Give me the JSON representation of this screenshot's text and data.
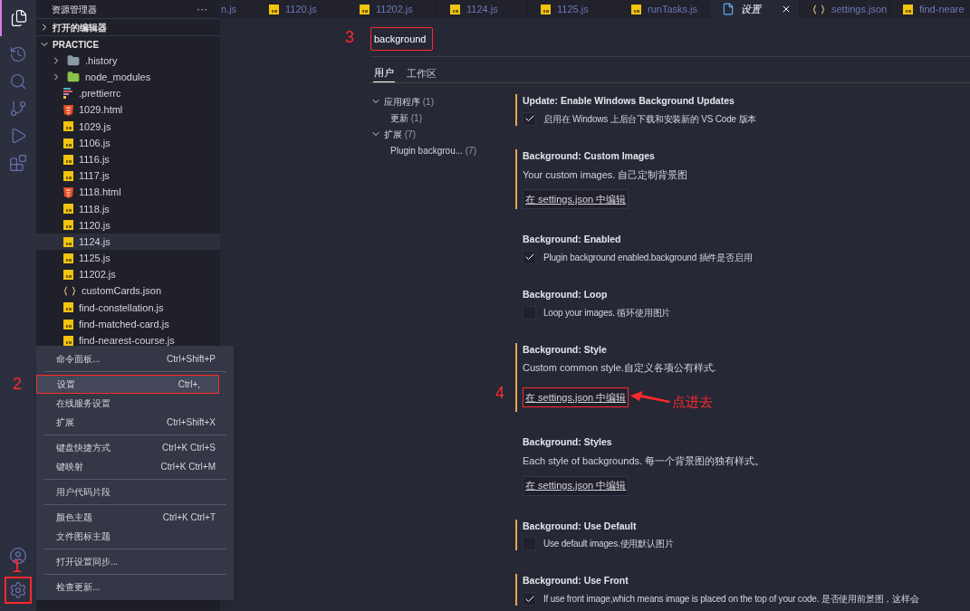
{
  "activity_bar": {
    "top": [
      {
        "kind": "files",
        "selected": true
      },
      {
        "kind": "timeline",
        "selected": false
      },
      {
        "kind": "search",
        "selected": false
      },
      {
        "kind": "source-control",
        "selected": false
      },
      {
        "kind": "run",
        "selected": false
      },
      {
        "kind": "extensions",
        "selected": false
      }
    ],
    "bottom": [
      {
        "kind": "account"
      },
      {
        "kind": "settings",
        "annotation": "1"
      }
    ]
  },
  "sidebar": {
    "title": "资源管理器",
    "more": "···",
    "sections": [
      {
        "label": "打开的编辑器",
        "expanded": false
      },
      {
        "label": "PRACTICE",
        "expanded": true
      }
    ],
    "files": [
      {
        "name": ".history",
        "kind": "folder",
        "selected": false
      },
      {
        "name": "node_modules",
        "kind": "node-folder",
        "selected": false
      },
      {
        "name": ".prettierrc",
        "kind": "prettier",
        "selected": false
      },
      {
        "name": "1029.html",
        "kind": "html",
        "selected": false
      },
      {
        "name": "1029.js",
        "kind": "js",
        "selected": false
      },
      {
        "name": "1106.js",
        "kind": "js",
        "selected": false
      },
      {
        "name": "1116.js",
        "kind": "js",
        "selected": false
      },
      {
        "name": "1117.js",
        "kind": "js",
        "selected": false
      },
      {
        "name": "1118.html",
        "kind": "html",
        "selected": false
      },
      {
        "name": "1118.js",
        "kind": "js",
        "selected": false
      },
      {
        "name": "1120.js",
        "kind": "js",
        "selected": false
      },
      {
        "name": "1124.js",
        "kind": "js",
        "selected": true
      },
      {
        "name": "1125.js",
        "kind": "js",
        "selected": false
      },
      {
        "name": "11202.js",
        "kind": "js",
        "selected": false
      },
      {
        "name": "customCards.json",
        "kind": "json",
        "selected": false
      },
      {
        "name": "find-constellation.js",
        "kind": "js",
        "selected": false
      },
      {
        "name": "find-matched-card.js",
        "kind": "js",
        "selected": false
      },
      {
        "name": "find-nearest-course.js",
        "kind": "js",
        "selected": false
      }
    ]
  },
  "menu": {
    "annotation": "2",
    "groups": [
      [
        {
          "label": "命令面板...",
          "shortcut": "Ctrl+Shift+P",
          "selected": false
        }
      ],
      [
        {
          "label": "设置",
          "shortcut": "Ctrl+,",
          "selected": true
        },
        {
          "label": "在线服务设置",
          "selected": false
        },
        {
          "label": "扩展",
          "shortcut": "Ctrl+Shift+X",
          "selected": false
        }
      ],
      [
        {
          "label": "键盘快捷方式",
          "shortcut": "Ctrl+K Ctrl+S",
          "selected": false
        },
        {
          "label": "键映射",
          "shortcut": "Ctrl+K Ctrl+M",
          "selected": false
        }
      ],
      [
        {
          "label": "用户代码片段",
          "selected": false
        }
      ],
      [
        {
          "label": "颜色主题",
          "shortcut": "Ctrl+K Ctrl+T",
          "selected": false
        },
        {
          "label": "文件图标主题",
          "selected": false
        }
      ],
      [
        {
          "label": "打开设置同步...",
          "selected": false
        }
      ],
      [
        {
          "label": "检查更新...",
          "selected": false
        }
      ]
    ]
  },
  "editor_tabs": [
    {
      "label": "n.js",
      "selected": false
    },
    {
      "label": "1120.js",
      "kind": "js",
      "selected": false
    },
    {
      "label": "11202.js",
      "kind": "js",
      "selected": false
    },
    {
      "label": "1124.js",
      "kind": "js",
      "selected": false
    },
    {
      "label": "1125.js",
      "kind": "js",
      "selected": false
    },
    {
      "label": "runTasks.js",
      "kind": "js",
      "selected": false
    },
    {
      "label": "设置",
      "kind": "settings",
      "selected": true
    },
    {
      "label": "settings.json",
      "kind": "json",
      "selected": false
    },
    {
      "label": "find-neare",
      "kind": "js",
      "selected": false
    }
  ],
  "settings": {
    "search": {
      "value": "background",
      "annotation": "3"
    },
    "scope_tabs": [
      {
        "label": "用户",
        "selected": true
      },
      {
        "label": "工作区",
        "selected": false
      }
    ],
    "toc": [
      {
        "label": "应用程序",
        "count": "(1)",
        "expanded": true,
        "children": [
          {
            "label": "更新",
            "count": "(1)"
          }
        ]
      },
      {
        "label": "扩展",
        "count": "(7)",
        "expanded": true,
        "children": [
          {
            "label": "Plugin backgrou...",
            "count": "(7)"
          }
        ]
      }
    ],
    "items": [
      {
        "title": "Update: Enable Windows Background Updates",
        "kind": "checkbox",
        "modified": true,
        "checked": true,
        "description": "启用在 Windows 上后台下载和安装新的 VS Code 版本"
      },
      {
        "title": "Background: Custom Images",
        "kind": "link",
        "modified": true,
        "description": "Your custom images. 自己定制背景图",
        "link": "在 settings.json 中编辑"
      },
      {
        "title": "Background: Enabled",
        "kind": "checkbox",
        "modified": false,
        "checked": true,
        "description": "Plugin background enabled.background 插件是否启用"
      },
      {
        "title": "Background: Loop",
        "kind": "checkbox",
        "modified": false,
        "checked": false,
        "description": "Loop your images. 循环使用图片"
      },
      {
        "title": "Background: Style",
        "kind": "link",
        "modified": true,
        "description": "Custom common style.自定义各项公有样式.",
        "link": "在 settings.json 中编辑",
        "annotation": "4",
        "callout": "点进去"
      },
      {
        "title": "Background: Styles",
        "kind": "link",
        "modified": false,
        "description": "Each style of backgrounds. 每一个背景图的独有样式。",
        "link": "在 settings.json 中编辑"
      },
      {
        "title": "Background: Use Default",
        "kind": "checkbox",
        "modified": true,
        "checked": false,
        "description": "Use default images.使用默认图片"
      },
      {
        "title": "Background: Use Front",
        "kind": "checkbox",
        "modified": true,
        "checked": true,
        "description": "If use front image,which means image is placed on the top of your code. 是否使用前景图，这样会"
      }
    ]
  }
}
